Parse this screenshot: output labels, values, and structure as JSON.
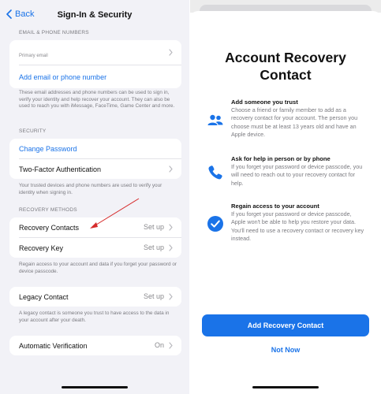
{
  "left": {
    "nav": {
      "back_label": "Back",
      "title": "Sign-In & Security"
    },
    "email_section": {
      "header": "EMAIL & PHONE NUMBERS",
      "primary_email_label": "Primary email",
      "add_link": "Add email or phone number",
      "footer": "These email addresses and phone numbers can be used to sign in, verify your identity and help recover your account. They can also be used to reach you with iMessage, FaceTime, Game Center and more."
    },
    "security_section": {
      "header": "SECURITY",
      "change_password": "Change Password",
      "two_factor": "Two-Factor Authentication",
      "footer": "Your trusted devices and phone numbers are used to verify your identity when signing in."
    },
    "recovery_section": {
      "header": "RECOVERY METHODS",
      "contacts_label": "Recovery Contacts",
      "contacts_value": "Set up",
      "key_label": "Recovery Key",
      "key_value": "Set up",
      "footer": "Regain access to your account and data if you forget your password or device passcode."
    },
    "legacy_section": {
      "label": "Legacy Contact",
      "value": "Set up",
      "footer": "A legacy contact is someone you trust to have access to the data in your account after your death."
    },
    "auto_verification": {
      "label": "Automatic Verification",
      "value": "On"
    }
  },
  "right": {
    "title": "Account Recovery Contact",
    "items": [
      {
        "icon": "people-icon",
        "heading": "Add someone you trust",
        "body": "Choose a friend or family member to add as a recovery contact for your account. The person you choose must be at least 13 years old and have an Apple device."
      },
      {
        "icon": "phone-icon",
        "heading": "Ask for help in person or by phone",
        "body": "If you forget your password or device passcode, you will need to reach out to your recovery contact for help."
      },
      {
        "icon": "checkmark-circle-icon",
        "heading": "Regain access to your account",
        "body": "If you forget your password or device passcode, Apple won't be able to help you restore your data. You'll need to use a recovery contact or recovery key instead."
      }
    ],
    "primary_button": "Add Recovery Contact",
    "secondary_button": "Not Now"
  },
  "colors": {
    "accent": "#1a73e8",
    "annotation_arrow": "#d62b2b",
    "background_grouped": "#f2f2f7"
  }
}
